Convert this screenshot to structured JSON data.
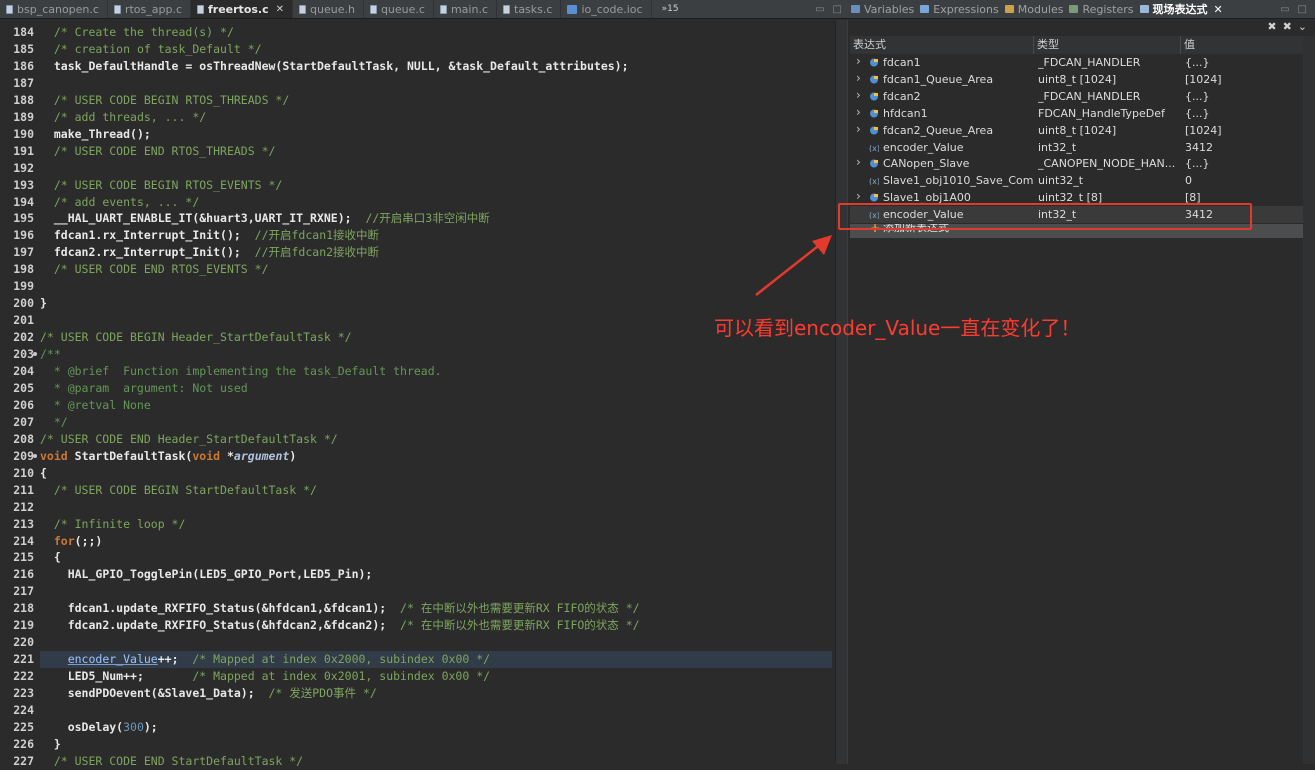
{
  "editor_tabs": [
    {
      "label": "bsp_canopen.c",
      "active": false
    },
    {
      "label": "rtos_app.c",
      "active": false
    },
    {
      "label": "freertos.c",
      "active": true,
      "close": "✕"
    },
    {
      "label": "queue.h",
      "active": false
    },
    {
      "label": "queue.c",
      "active": false
    },
    {
      "label": "main.c",
      "active": false
    },
    {
      "label": "tasks.c",
      "active": false
    },
    {
      "label": "io_code.ioc",
      "active": false,
      "icon": "ioc"
    }
  ],
  "editor_overflow": "»15",
  "panel_tabs": [
    {
      "label": "Variables",
      "active": false,
      "icon": "variables-icon"
    },
    {
      "label": "Expressions",
      "active": false,
      "icon": "expressions-icon"
    },
    {
      "label": "Modules",
      "active": false,
      "icon": "modules-icon"
    },
    {
      "label": "Registers",
      "active": false,
      "icon": "registers-icon"
    },
    {
      "label": "现场表达式",
      "active": true,
      "icon": "live-expressions-icon",
      "close": "✕"
    }
  ],
  "table": {
    "headers": [
      "表达式",
      "类型",
      "值"
    ],
    "rows": [
      {
        "expr": "fdcan1",
        "type": "_FDCAN_HANDLER",
        "value": "{...}",
        "expandable": true
      },
      {
        "expr": "fdcan1_Queue_Area",
        "type": "uint8_t [1024]",
        "value": "[1024]",
        "expandable": true
      },
      {
        "expr": "fdcan2",
        "type": "_FDCAN_HANDLER",
        "value": "{...}",
        "expandable": true
      },
      {
        "expr": "hfdcan1",
        "type": "FDCAN_HandleTypeDef",
        "value": "{...}",
        "expandable": true
      },
      {
        "expr": "fdcan2_Queue_Area",
        "type": "uint8_t [1024]",
        "value": "[1024]",
        "expandable": true
      },
      {
        "expr": "encoder_Value",
        "type": "int32_t",
        "value": "3412",
        "expandable": false
      },
      {
        "expr": "CANopen_Slave",
        "type": "_CANOPEN_NODE_HAN...",
        "value": "{...}",
        "expandable": true
      },
      {
        "expr": "Slave1_obj1010_Save_Comm",
        "type": "uint32_t",
        "value": "0",
        "expandable": false
      },
      {
        "expr": "Slave1_obj1A00",
        "type": "uint32_t [8]",
        "value": "[8]",
        "expandable": true
      },
      {
        "expr": "encoder_Value",
        "type": "int32_t",
        "value": "3412",
        "expandable": false
      }
    ],
    "add_expression": "添加新表达式"
  },
  "callout": "可以看到encoder_Value一直在变化了！",
  "colors": {
    "annotation_red": "#e23a2c",
    "accent_orange": "#cc7832"
  },
  "code_lines": [
    {
      "n": "184",
      "segs": [
        [
          "",
          "  "
        ],
        [
          "c",
          "/* Create the thread(s) */"
        ]
      ]
    },
    {
      "n": "185",
      "segs": [
        [
          "",
          "  "
        ],
        [
          "c",
          "/* creation of task_Default */"
        ]
      ]
    },
    {
      "n": "186",
      "segs": [
        [
          "",
          "  "
        ],
        [
          "pl",
          "task_DefaultHandle = osThreadNew(StartDefaultTask, NULL, &task_Default_attributes);"
        ]
      ]
    },
    {
      "n": "187",
      "segs": []
    },
    {
      "n": "188",
      "segs": [
        [
          "",
          "  "
        ],
        [
          "c",
          "/* USER CODE BEGIN RTOS_THREADS */"
        ]
      ]
    },
    {
      "n": "189",
      "segs": [
        [
          "",
          "  "
        ],
        [
          "c",
          "/* add threads, ... */"
        ]
      ]
    },
    {
      "n": "190",
      "segs": [
        [
          "",
          "  "
        ],
        [
          "pl",
          "make_Thread();"
        ]
      ]
    },
    {
      "n": "191",
      "segs": [
        [
          "",
          "  "
        ],
        [
          "c",
          "/* USER CODE END RTOS_THREADS */"
        ]
      ]
    },
    {
      "n": "192",
      "segs": []
    },
    {
      "n": "193",
      "segs": [
        [
          "",
          "  "
        ],
        [
          "c",
          "/* USER CODE BEGIN RTOS_EVENTS */"
        ]
      ]
    },
    {
      "n": "194",
      "segs": [
        [
          "",
          "  "
        ],
        [
          "c",
          "/* add events, ... */"
        ]
      ]
    },
    {
      "n": "195",
      "segs": [
        [
          "",
          "  "
        ],
        [
          "pl",
          "__HAL_UART_ENABLE_IT(&huart3,UART_IT_RXNE);"
        ],
        [
          "",
          " "
        ],
        [
          "c",
          " //开启串口3非空闲中断"
        ]
      ]
    },
    {
      "n": "196",
      "segs": [
        [
          "",
          "  "
        ],
        [
          "pl",
          "fdcan1.rx_Interrupt_Init();"
        ],
        [
          "",
          " "
        ],
        [
          "c",
          " //开启fdcan1接收中断"
        ]
      ]
    },
    {
      "n": "197",
      "segs": [
        [
          "",
          "  "
        ],
        [
          "pl",
          "fdcan2.rx_Interrupt_Init();"
        ],
        [
          "",
          " "
        ],
        [
          "c",
          " //开启fdcan2接收中断"
        ]
      ]
    },
    {
      "n": "198",
      "segs": [
        [
          "",
          "  "
        ],
        [
          "c",
          "/* USER CODE END RTOS_EVENTS */"
        ]
      ]
    },
    {
      "n": "199",
      "segs": []
    },
    {
      "n": "200",
      "segs": [
        [
          "pl",
          "}"
        ]
      ]
    },
    {
      "n": "201",
      "segs": []
    },
    {
      "n": "202",
      "segs": [
        [
          "c",
          "/* USER CODE BEGIN Header_StartDefaultTask */"
        ]
      ]
    },
    {
      "n": "203",
      "fold": true,
      "segs": [
        [
          "cb",
          "/**"
        ]
      ]
    },
    {
      "n": "204",
      "segs": [
        [
          "cb",
          "  * @brief  Function implementing the task_Default thread."
        ]
      ]
    },
    {
      "n": "205",
      "segs": [
        [
          "cb",
          "  * @param  argument: Not used"
        ]
      ]
    },
    {
      "n": "206",
      "segs": [
        [
          "cb",
          "  * @retval None"
        ]
      ]
    },
    {
      "n": "207",
      "segs": [
        [
          "cb",
          "  */"
        ]
      ]
    },
    {
      "n": "208",
      "segs": [
        [
          "c",
          "/* USER CODE END Header_StartDefaultTask */"
        ]
      ]
    },
    {
      "n": "209",
      "fold": true,
      "segs": [
        [
          "k",
          "void"
        ],
        [
          "",
          " "
        ],
        [
          "fn",
          "StartDefaultTask"
        ],
        [
          "pl",
          "("
        ],
        [
          "k",
          "void"
        ],
        [
          "pl",
          " *"
        ],
        [
          "pi",
          "argument"
        ],
        [
          "pl",
          ")"
        ]
      ]
    },
    {
      "n": "210",
      "segs": [
        [
          "pl",
          "{"
        ]
      ]
    },
    {
      "n": "211",
      "segs": [
        [
          "",
          "  "
        ],
        [
          "c",
          "/* USER CODE BEGIN StartDefaultTask */"
        ]
      ]
    },
    {
      "n": "212",
      "segs": []
    },
    {
      "n": "213",
      "segs": [
        [
          "",
          "  "
        ],
        [
          "c",
          "/* Infinite loop */"
        ]
      ]
    },
    {
      "n": "214",
      "segs": [
        [
          "",
          "  "
        ],
        [
          "k",
          "for"
        ],
        [
          "pl",
          "(;;)"
        ]
      ]
    },
    {
      "n": "215",
      "segs": [
        [
          "",
          "  "
        ],
        [
          "pl",
          "{"
        ]
      ]
    },
    {
      "n": "216",
      "segs": [
        [
          "",
          "    "
        ],
        [
          "pl",
          "HAL_GPIO_TogglePin(LED5_GPIO_Port,LED5_Pin);"
        ]
      ]
    },
    {
      "n": "217",
      "segs": []
    },
    {
      "n": "218",
      "segs": [
        [
          "",
          "    "
        ],
        [
          "pl",
          "fdcan1.update_RXFIFO_Status(&hfdcan1,&fdcan1);"
        ],
        [
          "c",
          "  /* 在中断以外也需要更新RX FIFO的状态 */"
        ]
      ]
    },
    {
      "n": "219",
      "segs": [
        [
          "",
          "    "
        ],
        [
          "pl",
          "fdcan2.update_RXFIFO_Status(&hfdcan2,&fdcan2);"
        ],
        [
          "c",
          "  /* 在中断以外也需要更新RX FIFO的状态 */"
        ]
      ]
    },
    {
      "n": "220",
      "segs": []
    },
    {
      "n": "221",
      "hl": true,
      "segs": [
        [
          "",
          "    "
        ],
        [
          "var",
          "encoder_Value"
        ],
        [
          "pl",
          "++;"
        ],
        [
          "c",
          "  /* Mapped at index 0x2000, subindex 0x00 */"
        ]
      ]
    },
    {
      "n": "222",
      "segs": [
        [
          "",
          "    "
        ],
        [
          "pl",
          "LED5_Num++;"
        ],
        [
          "c",
          "       /* Mapped at index 0x2001, subindex 0x00 */"
        ]
      ]
    },
    {
      "n": "223",
      "segs": [
        [
          "",
          "    "
        ],
        [
          "pl",
          "sendPDOevent(&Slave1_Data);"
        ],
        [
          "c",
          "  /* 发送PDO事件 */"
        ]
      ]
    },
    {
      "n": "224",
      "segs": []
    },
    {
      "n": "225",
      "segs": [
        [
          "",
          "    "
        ],
        [
          "pl",
          "osDelay("
        ],
        [
          "nm",
          "300"
        ],
        [
          "pl",
          ");"
        ]
      ]
    },
    {
      "n": "226",
      "segs": [
        [
          "",
          "  "
        ],
        [
          "pl",
          "}"
        ]
      ]
    },
    {
      "n": "227",
      "segs": [
        [
          "",
          "  "
        ],
        [
          "c",
          "/* USER CODE END StartDefaultTask */"
        ]
      ]
    }
  ]
}
